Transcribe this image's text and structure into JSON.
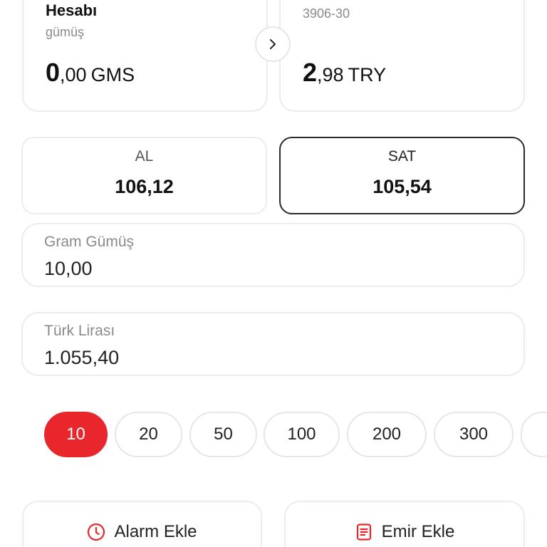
{
  "accounts": {
    "left": {
      "title": "Hesabı",
      "subtitle": "gümüş",
      "amount_int": "0",
      "amount_dec": ",00",
      "currency": "GMS"
    },
    "right": {
      "iban": "3906-30",
      "amount_int": "2",
      "amount_dec": ",98",
      "currency": "TRY"
    }
  },
  "trade": {
    "buy": {
      "label": "AL",
      "price": "106,12"
    },
    "sell": {
      "label": "SAT",
      "price": "105,54",
      "selected": true
    }
  },
  "inputs": {
    "gram": {
      "label": "Gram Gümüş",
      "value": "10,00"
    },
    "tl": {
      "label": "Türk Lirası",
      "value": "1.055,40"
    }
  },
  "quick_amounts": [
    "10",
    "20",
    "50",
    "100",
    "200",
    "300"
  ],
  "quick_amount_selected": "10",
  "actions": {
    "alarm": "Alarm Ekle",
    "order": "Emir Ekle"
  },
  "colors": {
    "accent": "#e8262c",
    "border": "#ececec",
    "selected_border": "#2a2a2a"
  }
}
